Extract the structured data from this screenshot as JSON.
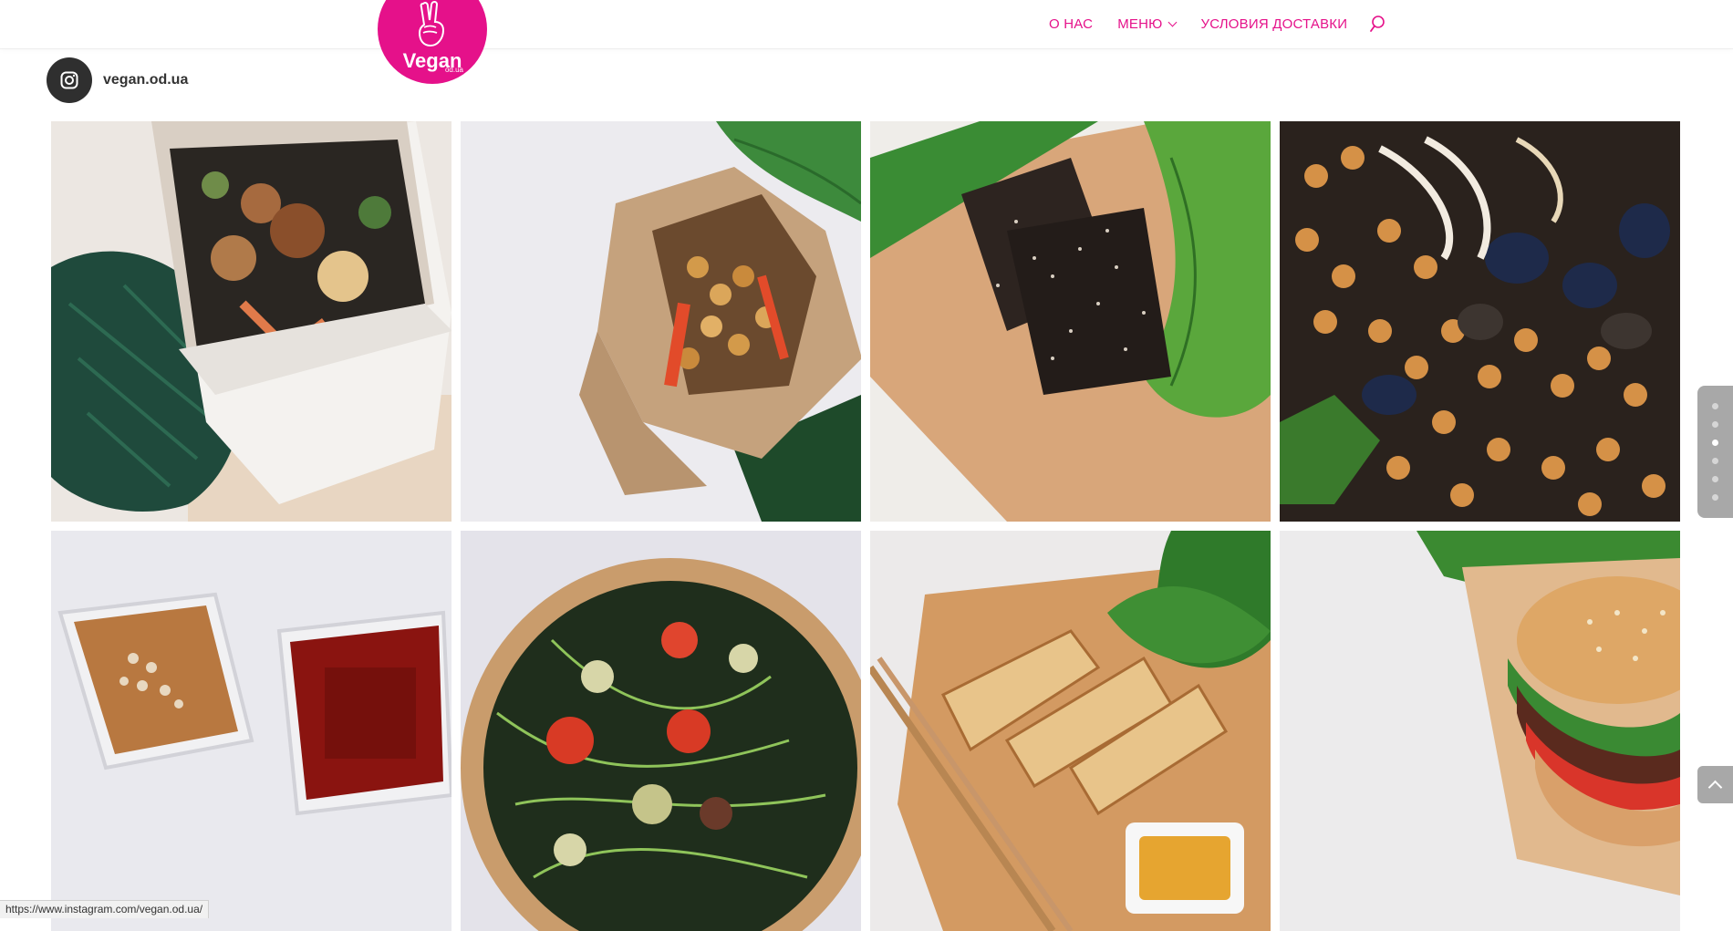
{
  "header": {
    "logo_text": "Vegan",
    "logo_subtext": "od.ua",
    "nav": [
      {
        "label": "О НАС"
      },
      {
        "label": "МЕНЮ"
      },
      {
        "label": "УСЛОВИЯ ДОСТАВКИ"
      }
    ],
    "brand_color": "#e5118a"
  },
  "instagram": {
    "handle": "vegan.od.ua",
    "icon": "instagram-icon"
  },
  "gallery": {
    "tiles": [
      {
        "name": "noodle-box-photo"
      },
      {
        "name": "chickpea-box-photo"
      },
      {
        "name": "brownie-board-photo"
      },
      {
        "name": "chickpea-eggplant-photo"
      },
      {
        "name": "sauces-photo"
      },
      {
        "name": "salad-bowl-photo"
      },
      {
        "name": "spring-rolls-photo"
      },
      {
        "name": "burger-photo"
      }
    ]
  },
  "side_nav": {
    "count": 6,
    "active_index": 2
  },
  "status_bar": {
    "url": "https://www.instagram.com/vegan.od.ua/"
  }
}
